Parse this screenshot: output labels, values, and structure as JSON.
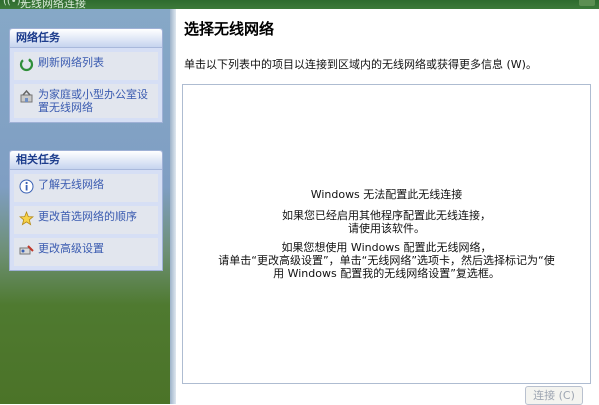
{
  "window": {
    "title": "无线网络连接"
  },
  "sidebar": {
    "network_tasks": {
      "header": "网络任务",
      "items": [
        {
          "label": "刷新网络列表",
          "icon": "refresh-icon"
        },
        {
          "label": "为家庭或小型办公室设置无线网络",
          "icon": "setup-wireless-icon"
        }
      ]
    },
    "related_tasks": {
      "header": "相关任务",
      "items": [
        {
          "label": "了解无线网络",
          "icon": "info-icon"
        },
        {
          "label": "更改首选网络的顺序",
          "icon": "star-icon"
        },
        {
          "label": "更改高级设置",
          "icon": "settings-icon"
        }
      ]
    }
  },
  "main": {
    "title": "选择无线网络",
    "subtitle": "单击以下列表中的项目以连接到区域内的无线网络或获得更多信息 (W)。",
    "message": {
      "line1": "Windows 无法配置此无线连接",
      "line2": "如果您已经启用其他程序配置此无线连接，",
      "line3": "请使用该软件。",
      "line4": "如果您想使用 Windows 配置此无线网络，",
      "line5": "请单击“更改高级设置”，单击“无线网络”选项卡，然后选择标记为“使",
      "line6": "用 Windows 配置我的无线网络设置”复选框。"
    },
    "connect_button": "连接 (C)"
  },
  "colors": {
    "task_link": "#3a5bb0",
    "panel_header_text": "#1c3c8c",
    "disabled_text": "#9ea6b2"
  }
}
